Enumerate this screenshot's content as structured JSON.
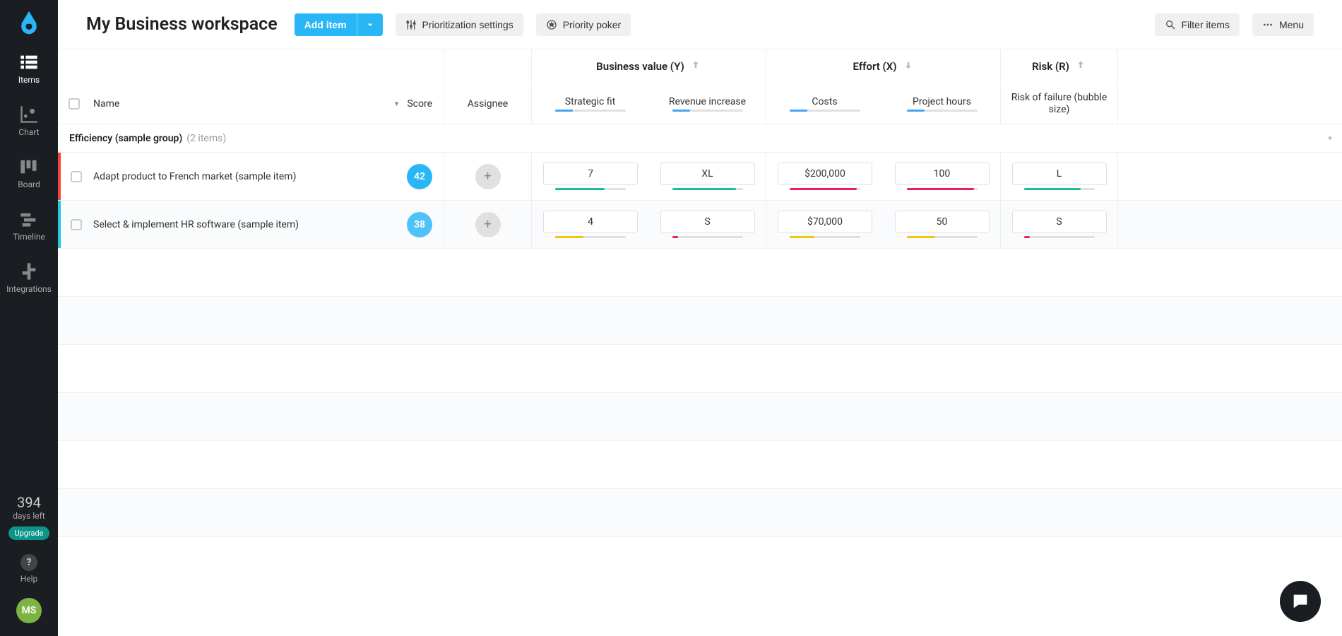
{
  "sidebar": {
    "nav": [
      {
        "label": "Items"
      },
      {
        "label": "Chart"
      },
      {
        "label": "Board"
      },
      {
        "label": "Timeline"
      },
      {
        "label": "Integrations"
      }
    ],
    "trial": {
      "days": "394",
      "left": "days left",
      "upgrade": "Upgrade"
    },
    "help": "Help",
    "avatar": "MS"
  },
  "topbar": {
    "title": "My Business workspace",
    "add": "Add item",
    "prio": "Prioritization settings",
    "poker": "Priority poker",
    "filter": "Filter items",
    "menu": "Menu"
  },
  "columns": {
    "name": "Name",
    "score": "Score",
    "assignee": "Assignee",
    "bv": "Business value (Y)",
    "ef": "Effort (X)",
    "rk": "Risk (R)",
    "strategic": "Strategic fit",
    "revenue": "Revenue increase",
    "costs": "Costs",
    "hours": "Project hours",
    "risk_sub": "Risk of failure (bubble size)"
  },
  "group": {
    "name": "Efficiency (sample group)",
    "count": "(2 items)"
  },
  "rows": [
    {
      "color": "color-red",
      "name": "Adapt product to French market (sample item)",
      "score": "42",
      "score_cls": "score-42",
      "strategic": {
        "v": "7",
        "c": "c-teal",
        "w": "70%"
      },
      "revenue": {
        "v": "XL",
        "c": "c-teal",
        "w": "90%"
      },
      "costs": {
        "v": "$200,000",
        "c": "c-pink",
        "w": "95%"
      },
      "hours": {
        "v": "100",
        "c": "c-pink",
        "w": "95%"
      },
      "risk": {
        "v": "L",
        "c": "c-teal",
        "w": "80%"
      }
    },
    {
      "color": "color-cyan",
      "name": "Select & implement HR software (sample item)",
      "score": "38",
      "score_cls": "score-38",
      "strategic": {
        "v": "4",
        "c": "c-yellow",
        "w": "40%"
      },
      "revenue": {
        "v": "S",
        "c": "c-pink",
        "w": "8%"
      },
      "costs": {
        "v": "$70,000",
        "c": "c-yellow",
        "w": "35%"
      },
      "hours": {
        "v": "50",
        "c": "c-yellow",
        "w": "40%"
      },
      "risk": {
        "v": "S",
        "c": "c-pink",
        "w": "8%"
      }
    }
  ]
}
